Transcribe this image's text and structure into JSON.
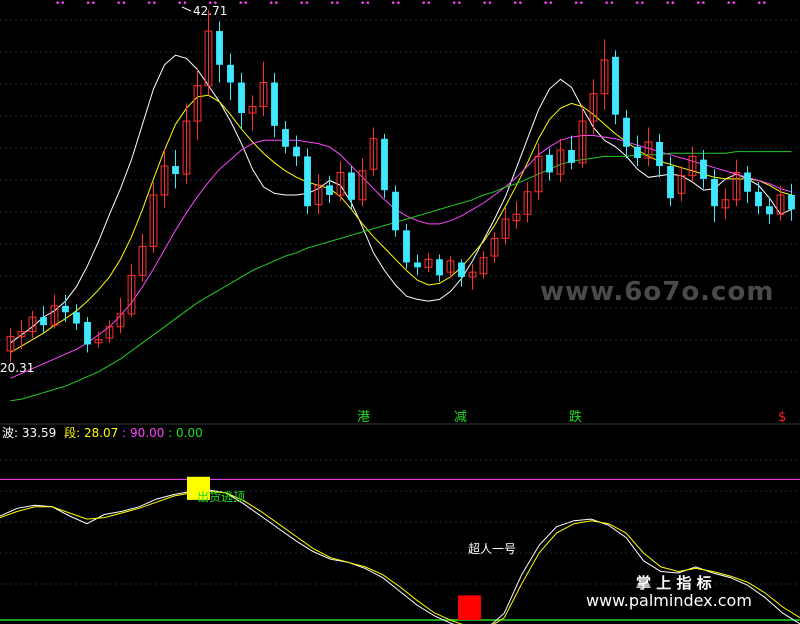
{
  "chart_data": [
    {
      "type": "candlestick",
      "panel": "main",
      "y_min": 20.31,
      "y_max": 42.71,
      "price_labels": {
        "high": "42.71",
        "low": "20.31"
      },
      "up_color": "#ff3030",
      "down_color": "#40e8ff",
      "moving_averages": [
        {
          "color": "#ffffff",
          "values": [
            22.0,
            22.5,
            23.0,
            23.6,
            24.0,
            24.6,
            25.5,
            26.8,
            28.3,
            30.0,
            31.6,
            33.4,
            35.6,
            37.8,
            39.3,
            39.9,
            39.7,
            39.0,
            38.0,
            37.0,
            35.8,
            34.4,
            32.8,
            31.7,
            31.3,
            31.2,
            31.2,
            31.3,
            31.6,
            32.1,
            31.8,
            30.7,
            29.2,
            27.6,
            26.5,
            25.6,
            24.9,
            24.7,
            24.6,
            24.7,
            25.2,
            26.0,
            27.1,
            28.4,
            29.7,
            31.1,
            32.9,
            34.7,
            36.5,
            37.8,
            38.4,
            37.9,
            36.6,
            35.4,
            34.6,
            34.2,
            33.6,
            32.8,
            32.3,
            32.4,
            32.5,
            32.4,
            32.0,
            31.5,
            31.6,
            32.2,
            32.5,
            32.2,
            31.8,
            31.0,
            30.0,
            30.3
          ]
        },
        {
          "color": "#ffff00",
          "values": [
            21.4,
            21.8,
            22.2,
            22.6,
            23.1,
            23.5,
            24.0,
            24.6,
            25.3,
            26.1,
            27.2,
            28.6,
            30.3,
            32.2,
            34.0,
            35.6,
            36.6,
            37.3,
            37.4,
            37.0,
            36.2,
            35.3,
            34.5,
            33.8,
            33.2,
            32.7,
            32.3,
            32.0,
            31.8,
            31.6,
            31.1,
            30.3,
            29.4,
            28.6,
            27.9,
            27.2,
            26.5,
            25.9,
            25.6,
            25.7,
            26.1,
            26.7,
            27.5,
            28.3,
            29.3,
            30.5,
            31.8,
            33.2,
            34.7,
            35.9,
            36.6,
            36.9,
            36.7,
            36.2,
            35.6,
            35.0,
            34.5,
            34.0,
            33.6,
            33.3,
            33.1,
            32.9,
            32.7,
            32.5,
            32.3,
            32.2,
            32.2,
            32.2,
            32.1,
            31.8,
            31.4,
            31.2
          ]
        },
        {
          "color": "#ff44ff",
          "values": [
            19.8,
            20.1,
            20.4,
            20.7,
            21.0,
            21.3,
            21.6,
            22.0,
            22.5,
            23.0,
            23.7,
            24.5,
            25.5,
            26.6,
            27.8,
            29.0,
            30.1,
            31.1,
            32.0,
            32.8,
            33.4,
            34.0,
            34.4,
            34.6,
            34.6,
            34.6,
            34.6,
            34.5,
            34.4,
            34.2,
            33.7,
            33.0,
            32.3,
            31.6,
            30.9,
            30.3,
            29.9,
            29.6,
            29.4,
            29.4,
            29.6,
            29.9,
            30.3,
            30.7,
            31.2,
            31.7,
            32.3,
            33.0,
            33.7,
            34.2,
            34.6,
            34.8,
            34.9,
            34.9,
            34.8,
            34.7,
            34.5,
            34.3,
            34.1,
            33.9,
            33.7,
            33.5,
            33.3,
            33.1,
            32.9,
            32.7,
            32.5,
            32.3,
            32.1,
            31.9,
            31.6,
            31.4
          ]
        },
        {
          "color": "#22cc22",
          "values": [
            18.4,
            18.5,
            18.7,
            18.9,
            19.1,
            19.3,
            19.6,
            19.9,
            20.2,
            20.6,
            21.0,
            21.5,
            22.0,
            22.5,
            23.0,
            23.5,
            24.0,
            24.5,
            24.9,
            25.3,
            25.7,
            26.1,
            26.5,
            26.8,
            27.1,
            27.4,
            27.6,
            27.9,
            28.1,
            28.3,
            28.5,
            28.7,
            28.9,
            29.1,
            29.3,
            29.5,
            29.7,
            29.9,
            30.1,
            30.3,
            30.5,
            30.7,
            30.9,
            31.2,
            31.4,
            31.7,
            31.9,
            32.2,
            32.5,
            32.8,
            33.1,
            33.3,
            33.4,
            33.5,
            33.6,
            33.6,
            33.6,
            33.7,
            33.7,
            33.7,
            33.8,
            33.8,
            33.8,
            33.8,
            33.8,
            33.8,
            33.9,
            33.9,
            33.9,
            33.9,
            33.9,
            33.9
          ]
        }
      ],
      "candles": [
        [
          21.5,
          22.4,
          20.8,
          22.9
        ],
        [
          22.4,
          22.7,
          21.6,
          23.4
        ],
        [
          22.7,
          23.6,
          22.3,
          24.0
        ],
        [
          23.6,
          23.1,
          22.6,
          24.3
        ],
        [
          23.1,
          24.3,
          22.9,
          25.0
        ],
        [
          24.3,
          23.9,
          23.3,
          25.0
        ],
        [
          23.9,
          23.2,
          22.8,
          24.4
        ],
        [
          23.3,
          21.9,
          21.4,
          23.6
        ],
        [
          22.0,
          22.2,
          21.7,
          22.7
        ],
        [
          22.3,
          23.0,
          22.0,
          23.4
        ],
        [
          23.0,
          23.8,
          22.6,
          24.8
        ],
        [
          23.8,
          26.2,
          23.6,
          26.9
        ],
        [
          26.2,
          28.0,
          25.8,
          28.8
        ],
        [
          28.0,
          31.2,
          27.6,
          32.0
        ],
        [
          31.2,
          33.0,
          30.4,
          34.1
        ],
        [
          33.0,
          32.5,
          31.6,
          34.0
        ],
        [
          32.5,
          35.8,
          31.9,
          36.9
        ],
        [
          35.8,
          38.0,
          34.6,
          39.1
        ],
        [
          38.0,
          41.4,
          37.4,
          42.71
        ],
        [
          41.4,
          39.3,
          38.2,
          42.0
        ],
        [
          39.3,
          38.2,
          37.1,
          40.0
        ],
        [
          38.2,
          36.3,
          35.3,
          38.8
        ],
        [
          36.3,
          36.7,
          35.2,
          37.4
        ],
        [
          36.7,
          38.2,
          36.1,
          39.5
        ],
        [
          38.2,
          35.5,
          34.8,
          38.8
        ],
        [
          35.3,
          34.2,
          33.8,
          35.8
        ],
        [
          34.2,
          33.6,
          33.0,
          34.9
        ],
        [
          33.6,
          30.5,
          30.0,
          34.1
        ],
        [
          30.6,
          31.8,
          30.0,
          32.5
        ],
        [
          31.8,
          31.2,
          30.7,
          32.4
        ],
        [
          31.2,
          32.6,
          30.8,
          33.3
        ],
        [
          32.6,
          30.9,
          30.3,
          33.0
        ],
        [
          30.9,
          32.7,
          30.5,
          33.5
        ],
        [
          32.8,
          34.7,
          32.4,
          35.4
        ],
        [
          34.7,
          31.5,
          31.0,
          35.0
        ],
        [
          31.4,
          29.0,
          28.6,
          31.8
        ],
        [
          29.0,
          27.0,
          26.6,
          29.4
        ],
        [
          27.0,
          26.7,
          26.2,
          27.5
        ],
        [
          26.7,
          27.2,
          26.4,
          27.6
        ],
        [
          27.2,
          26.2,
          25.8,
          27.5
        ],
        [
          26.4,
          27.1,
          26.0,
          27.4
        ],
        [
          27.0,
          26.1,
          25.5,
          27.2
        ],
        [
          26.1,
          26.4,
          25.3,
          26.9
        ],
        [
          26.3,
          27.3,
          26.0,
          27.7
        ],
        [
          27.4,
          28.5,
          27.0,
          28.9
        ],
        [
          28.5,
          29.7,
          28.1,
          30.4
        ],
        [
          29.6,
          30.0,
          29.1,
          30.8
        ],
        [
          30.0,
          31.4,
          29.5,
          32.0
        ],
        [
          31.4,
          33.6,
          30.9,
          34.4
        ],
        [
          33.7,
          32.6,
          32.1,
          34.1
        ],
        [
          32.5,
          34.0,
          32.0,
          34.7
        ],
        [
          34.0,
          33.2,
          32.8,
          34.9
        ],
        [
          33.2,
          35.8,
          32.9,
          36.8
        ],
        [
          35.8,
          37.5,
          35.0,
          38.4
        ],
        [
          37.5,
          39.6,
          36.5,
          40.9
        ],
        [
          39.8,
          36.2,
          35.6,
          40.2
        ],
        [
          36.0,
          34.2,
          33.5,
          36.5
        ],
        [
          34.2,
          33.5,
          33.0,
          34.9
        ],
        [
          33.5,
          34.5,
          33.0,
          35.4
        ],
        [
          34.5,
          33.0,
          32.3,
          35.0
        ],
        [
          33.0,
          31.0,
          30.5,
          33.6
        ],
        [
          31.3,
          32.4,
          30.8,
          33.0
        ],
        [
          32.4,
          33.6,
          32.0,
          34.2
        ],
        [
          33.4,
          32.2,
          31.6,
          34.0
        ],
        [
          32.2,
          30.5,
          29.5,
          32.8
        ],
        [
          30.4,
          30.9,
          29.7,
          31.6
        ],
        [
          30.9,
          32.6,
          30.5,
          33.4
        ],
        [
          32.6,
          31.4,
          30.7,
          33.0
        ],
        [
          31.4,
          30.5,
          30.0,
          32.0
        ],
        [
          30.5,
          30.0,
          29.4,
          31.0
        ],
        [
          30.0,
          31.2,
          29.6,
          31.8
        ],
        [
          31.2,
          30.3,
          29.6,
          31.9
        ]
      ],
      "top_markers": [
        "•",
        "•",
        "•",
        "•",
        "•",
        "•",
        "•",
        "•",
        "•",
        "•",
        "•",
        "•",
        "•",
        "•",
        "•",
        "•",
        "•",
        "•",
        "•",
        "•",
        "•",
        "•",
        "•",
        "•"
      ],
      "signal_labels": [
        {
          "text": "港",
          "color": "#22dd22"
        },
        {
          "text": "减",
          "color": "#22dd22"
        },
        {
          "text": "跌",
          "color": "#22dd22"
        },
        {
          "text": "$",
          "color": "#ff2222"
        }
      ],
      "watermark": "www.6o7o.com"
    },
    {
      "type": "line",
      "panel": "oscillator",
      "y_min": 0,
      "y_max": 100,
      "legend": [
        {
          "label": "波",
          "value": "33.59",
          "color": "#ffffff"
        },
        {
          "label": "段",
          "value": "28.07",
          "color": "#ffff00"
        },
        {
          "value": "90.00",
          "color": "#ff44ff"
        },
        {
          "value": "0.00",
          "color": "#22dd22"
        }
      ],
      "reference_lines": [
        {
          "value": 90,
          "color": "#ff44ff"
        },
        {
          "value": 0,
          "color": "#22dd22"
        }
      ],
      "series": [
        {
          "color": "#ffffff",
          "values": [
            74,
            79,
            81,
            80,
            74,
            69,
            75,
            77,
            80,
            85,
            88,
            90,
            91,
            89,
            82,
            74,
            66,
            58,
            51,
            46,
            44,
            40,
            34,
            25,
            16,
            9,
            4,
            1,
            1,
            11,
            36,
            55,
            67,
            71,
            72,
            68,
            60,
            45,
            38,
            37,
            41,
            37,
            34,
            29,
            21,
            11,
            4
          ]
        },
        {
          "color": "#ffff00",
          "values": [
            73,
            77,
            80,
            80,
            76,
            72,
            73,
            76,
            79,
            83,
            87,
            89,
            90,
            89,
            84,
            77,
            69,
            61,
            53,
            47,
            44,
            41,
            36,
            28,
            19,
            11,
            6,
            2,
            1,
            8,
            30,
            50,
            63,
            69,
            71,
            69,
            63,
            50,
            41,
            38,
            40,
            38,
            35,
            31,
            24,
            15,
            8
          ]
        }
      ],
      "signal_boxes": [
        {
          "color": "#ffff00",
          "label": "出货逃顶",
          "label_color": "#22dd22",
          "top": 93,
          "bottom": 78
        },
        {
          "color": "#ff0000",
          "label": "超人一号",
          "label_color": "#ffffff",
          "top": 16,
          "bottom": 0
        }
      ]
    }
  ],
  "branding": {
    "line1": "掌 上 指 标",
    "line2": "www.palmindex.com"
  }
}
